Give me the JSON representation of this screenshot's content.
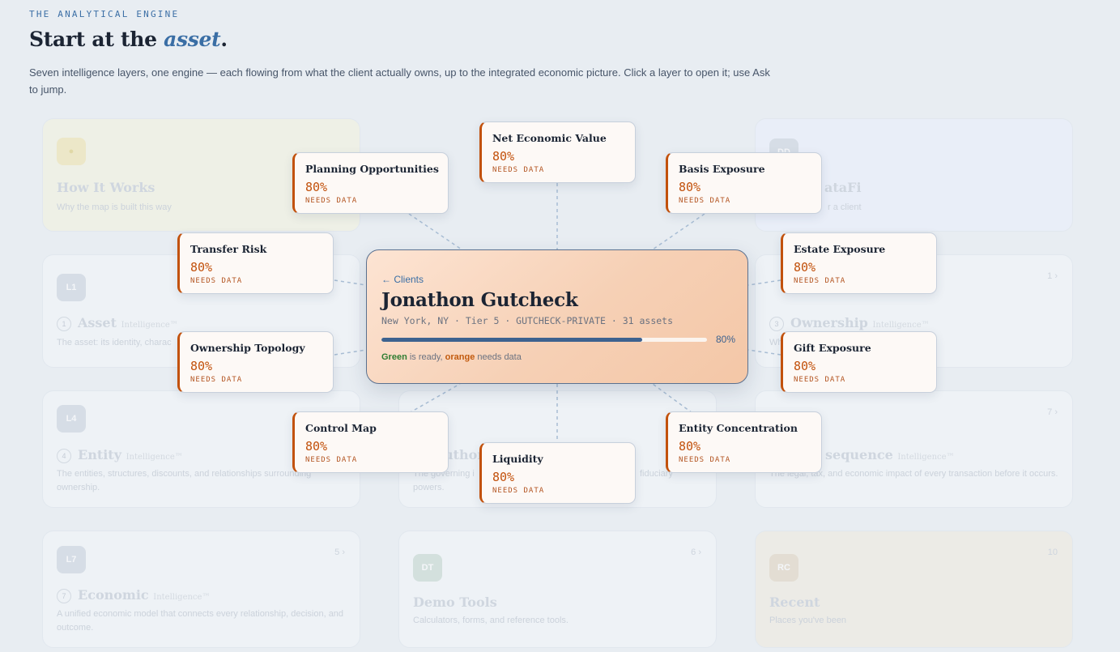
{
  "header": {
    "eyebrow": "THE ANALYTICAL ENGINE",
    "title_prefix": "Start at the ",
    "title_accent": "asset",
    "title_suffix": ".",
    "intro": "Seven intelligence layers, one engine — each flowing from what the client actually owns, up to the integrated economic picture. Click a layer to open it; use Ask to jump."
  },
  "client": {
    "back_label": "← Clients",
    "name": "Jonathon Gutcheck",
    "meta": "New York, NY · Tier 5 · GUTCHECK-PRIVATE · 31 assets",
    "progress": 80,
    "progress_label": "80%",
    "legend_green": "Green",
    "legend_mid": " is ready, ",
    "legend_orange": "orange",
    "legend_end": " needs data"
  },
  "layers": [
    {
      "name": "Net Economic Value",
      "pct": "80%",
      "status": "NEEDS DATA"
    },
    {
      "name": "Planning Opportunities",
      "pct": "80%",
      "status": "NEEDS DATA"
    },
    {
      "name": "Basis Exposure",
      "pct": "80%",
      "status": "NEEDS DATA"
    },
    {
      "name": "Transfer Risk",
      "pct": "80%",
      "status": "NEEDS DATA"
    },
    {
      "name": "Estate Exposure",
      "pct": "80%",
      "status": "NEEDS DATA"
    },
    {
      "name": "Ownership Topology",
      "pct": "80%",
      "status": "NEEDS DATA"
    },
    {
      "name": "Gift Exposure",
      "pct": "80%",
      "status": "NEEDS DATA"
    },
    {
      "name": "Control Map",
      "pct": "80%",
      "status": "NEEDS DATA"
    },
    {
      "name": "Entity Concentration",
      "pct": "80%",
      "status": "NEEDS DATA"
    },
    {
      "name": "Liquidity",
      "pct": "80%",
      "status": "NEEDS DATA"
    }
  ],
  "background": {
    "how_it_works": {
      "title": "How It Works",
      "sub": "Why the map is built this way"
    },
    "datafi": {
      "badge": "DD",
      "title": "ataFi",
      "sub": "r a client"
    },
    "asset": {
      "badge": "L1",
      "num": "1",
      "title": "Asset",
      "tm": "Intelligence™",
      "sub": "The asset: its identity, charac"
    },
    "ownership": {
      "badge": "L3",
      "num": "3",
      "title": "Ownership",
      "tm": "Intelligence™",
      "sub": "Wh",
      "count": "1 ›"
    },
    "entity": {
      "badge": "L4",
      "num": "4",
      "title": "Entity",
      "tm": "Intelligence™",
      "sub": "The entities, structures, discounts, and relationships surrounding ownership."
    },
    "authority": {
      "badge": "L5",
      "title": "uthor",
      "sub": "The governing i",
      "sub2": "fiduciary",
      "sub3": "powers."
    },
    "consequence": {
      "badge": "L6",
      "title": "sequence",
      "tm": "Intelligence™",
      "sub": "The legal, tax, and economic impact of every transaction before it occurs.",
      "count": "7 ›"
    },
    "economic": {
      "badge": "L7",
      "num": "7",
      "title": "Economic",
      "tm": "Intelligence™",
      "sub": "A unified economic model that connects every relationship, decision, and outcome.",
      "count": "5 ›"
    },
    "demo_tools": {
      "badge": "DT",
      "title": "Demo Tools",
      "sub": "Calculators, forms, and reference tools.",
      "count": "6 ›"
    },
    "recent": {
      "badge": "RC",
      "title": "Recent",
      "sub": "Places you've been",
      "count": "10"
    }
  }
}
